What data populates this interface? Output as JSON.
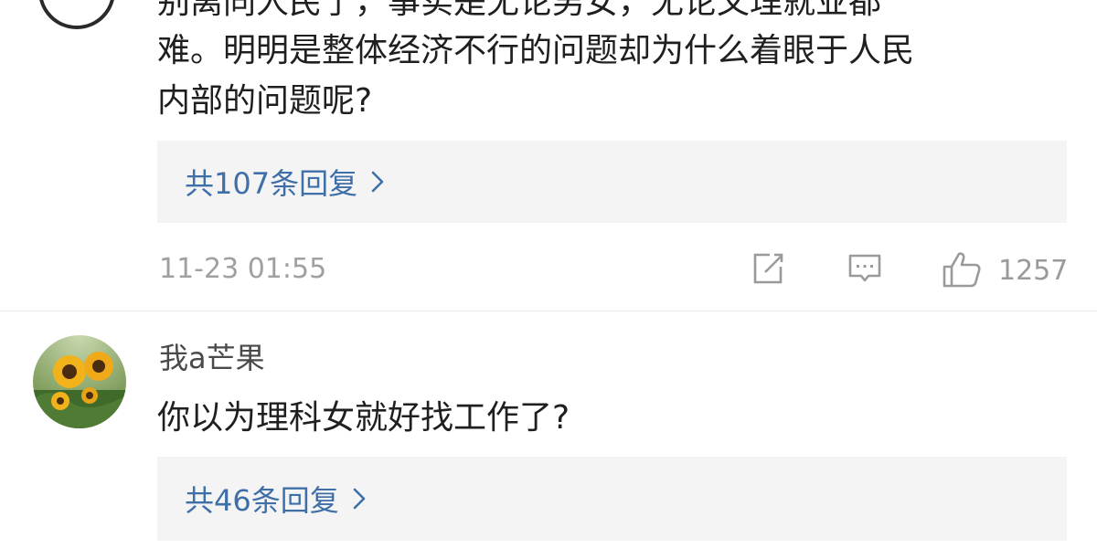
{
  "comment1": {
    "text_line_partial": "别离同人民了，事实是无论男女，无论文理就业都",
    "text_line_2": "难。明明是整体经济不行的问题却为什么着眼于人民",
    "text_line_3": "内部的问题呢?",
    "replies_label": "共107条回复",
    "timestamp": "11-23 01:55",
    "like_count": "1257"
  },
  "comment2": {
    "username": "我a芒果",
    "text": "你以为理科女就好找工作了?",
    "replies_label": "共46条回复"
  },
  "icons": {
    "share": "share-icon",
    "comment": "comment-icon",
    "like": "like-icon",
    "chevron": "chevron-right-icon"
  },
  "colors": {
    "link": "#3f6fa8",
    "meta": "#a0a0a0",
    "reply_bg": "#f4f4f4"
  }
}
